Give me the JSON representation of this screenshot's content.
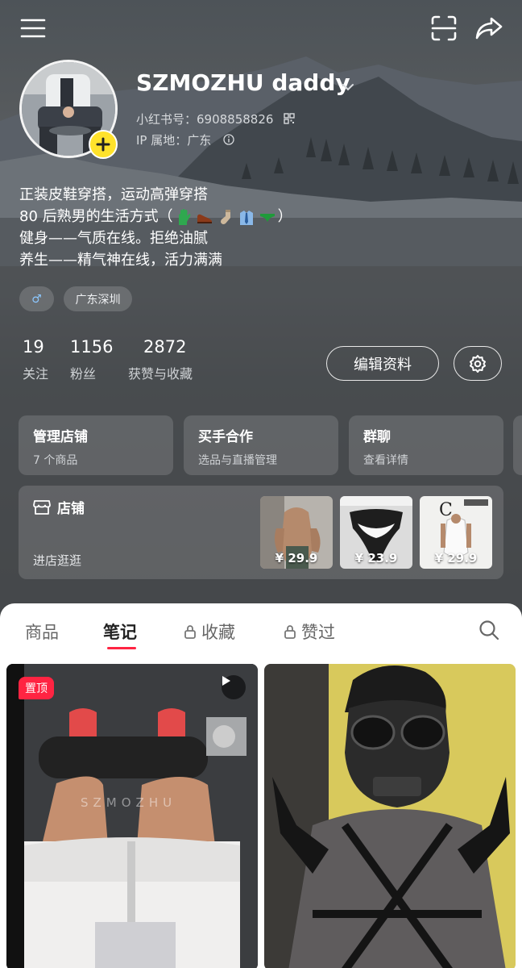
{
  "header": {
    "menu_icon": "menu-icon",
    "scan_icon": "scan-icon",
    "share_icon": "share-icon"
  },
  "profile": {
    "username": "SZMOZHU daddy",
    "red_id": "小红书号：6908858826",
    "ip_location": "IP 属地：广东",
    "bio_lines": [
      "正装皮鞋穿搭，运动高弹穿搭",
      "80 后熟男的生活方式（",
      "）",
      "健身——气质在线。拒绝油腻",
      "养生——精气神在线，活力满满"
    ],
    "bio_emojis": [
      "glove-emoji",
      "shoe-emoji",
      "sock-emoji",
      "shirt-tie-emoji",
      "underwear-emoji"
    ],
    "tags": {
      "gender": "♂",
      "location": "广东深圳"
    }
  },
  "stats": [
    {
      "value": "19",
      "label": "关注"
    },
    {
      "value": "1156",
      "label": "粉丝"
    },
    {
      "value": "2872",
      "label": "获赞与收藏"
    }
  ],
  "actions": {
    "edit_label": "编辑资料",
    "settings_icon": "gear-icon"
  },
  "cards": [
    {
      "title": "管理店铺",
      "subtitle": "7 个商品"
    },
    {
      "title": "买手合作",
      "subtitle": "选品与直播管理"
    },
    {
      "title": "群聊",
      "subtitle": "查看详情"
    }
  ],
  "shop": {
    "title": "店铺",
    "subtitle": "进店逛逛",
    "products": [
      {
        "price": "¥ 29.9"
      },
      {
        "price": "¥ 23.9"
      },
      {
        "price": "¥ 29.9"
      }
    ]
  },
  "tabs": {
    "items": [
      {
        "label": "商品",
        "locked": false,
        "active": false
      },
      {
        "label": "笔记",
        "locked": false,
        "active": true
      },
      {
        "label": "收藏",
        "locked": true,
        "active": false
      },
      {
        "label": "赞过",
        "locked": true,
        "active": false
      }
    ],
    "search_icon": "search-icon"
  },
  "notes": [
    {
      "badge": "置顶",
      "watermark": "SZMOZHU",
      "is_video": true
    },
    {
      "badge": "",
      "watermark": "",
      "is_video": false
    }
  ],
  "colors": {
    "accent": "#ff2442",
    "add_badge": "#ffe22b",
    "sheet": "#ffffff"
  }
}
